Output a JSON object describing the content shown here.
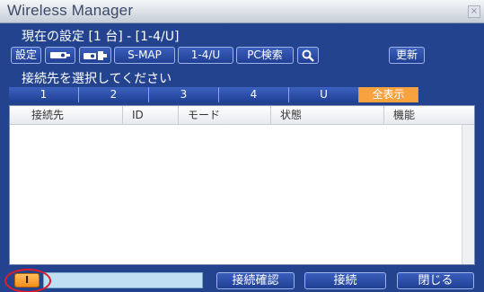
{
  "window": {
    "title": "Wireless Manager",
    "close_glyph": "×"
  },
  "settings": {
    "label": "現在の設定 [1 台] - [1-4/U]"
  },
  "toolbar": {
    "settings_label": "設定",
    "icon1": "projector-icon",
    "icon2": "projector-connect-icon",
    "smap_label": "S-MAP",
    "range_label": "1-4/U",
    "pc_search_label": "PC検索",
    "search_icon": "magnifier-icon",
    "refresh_label": "更新"
  },
  "select": {
    "label": "接続先を選択してください"
  },
  "tabs": [
    {
      "label": "1"
    },
    {
      "label": "2"
    },
    {
      "label": "3"
    },
    {
      "label": "4"
    },
    {
      "label": "U"
    },
    {
      "label": "全表示",
      "active": true
    }
  ],
  "list": {
    "columns": [
      "接続先",
      "ID",
      "モード",
      "状態",
      "機能"
    ],
    "rows": []
  },
  "bottom": {
    "status_icon_label": "I",
    "status_text": "",
    "confirm_label": "接続確認",
    "connect_label": "接続",
    "close_label": "閉じる"
  },
  "colors": {
    "window_bg": "#24438f",
    "active_tab": "#f7a23e",
    "highlight": "#e01c2a",
    "status_field": "#bfe0f2"
  }
}
